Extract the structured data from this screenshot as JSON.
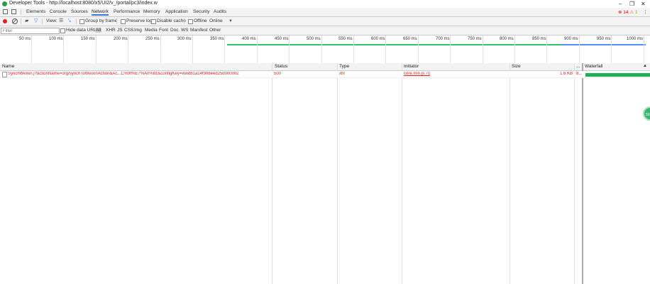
{
  "window": {
    "title": "Developer Tools - http://localhost:8080/x5/UI2/v_/portal/pc3/index.w"
  },
  "tabs": [
    "Elements",
    "Console",
    "Sources",
    "Network",
    "Performance",
    "Memory",
    "Application",
    "Security",
    "Audits"
  ],
  "active_tab": "Network",
  "status": {
    "errors": "14",
    "warnings": "1"
  },
  "toolbar": {
    "view_label": "View:",
    "group_by_frame": "Group by frame",
    "preserve_log": "Preserve log",
    "disable_cache": "Disable cache",
    "offline": "Offline",
    "throttle": "Online"
  },
  "filterbar": {
    "placeholder": "Filter",
    "hide_data_urls": "Hide data URLs",
    "types": [
      "All",
      "XHR",
      "JS",
      "CSS",
      "Img",
      "Media",
      "Font",
      "Doc",
      "WS",
      "Manifest",
      "Other"
    ]
  },
  "timeline": {
    "ticks": [
      "50 ms",
      "100 ms",
      "150 ms",
      "200 ms",
      "250 ms",
      "300 ms",
      "350 ms",
      "400 ms",
      "450 ms",
      "500 ms",
      "550 ms",
      "600 ms",
      "650 ms",
      "700 ms",
      "750 ms",
      "800 ms",
      "850 ms",
      "900 ms",
      "950 ms",
      "1000 ms"
    ]
  },
  "table": {
    "headers": {
      "name": "Name",
      "status": "Status",
      "type": "Type",
      "initiator": "Initiator",
      "size": "Size",
      "time": "...",
      "waterfall": "Waterfall"
    },
    "rows": [
      {
        "name": "SynchWeixin.j?actionName=org/synchToWeixinAction&Ac...C%9f%E7%A0%81&configKey=wwd81a14f908eed25d000002",
        "status": "500",
        "type": "xhr",
        "initiator": "core.min.js:71",
        "size": "1.6 KB",
        "time": "8..."
      }
    ]
  },
  "float_button": {
    "label": "55"
  },
  "colors": {
    "accent": "#3879d9",
    "error": "#d22222",
    "waterfall": "#1fae55"
  }
}
